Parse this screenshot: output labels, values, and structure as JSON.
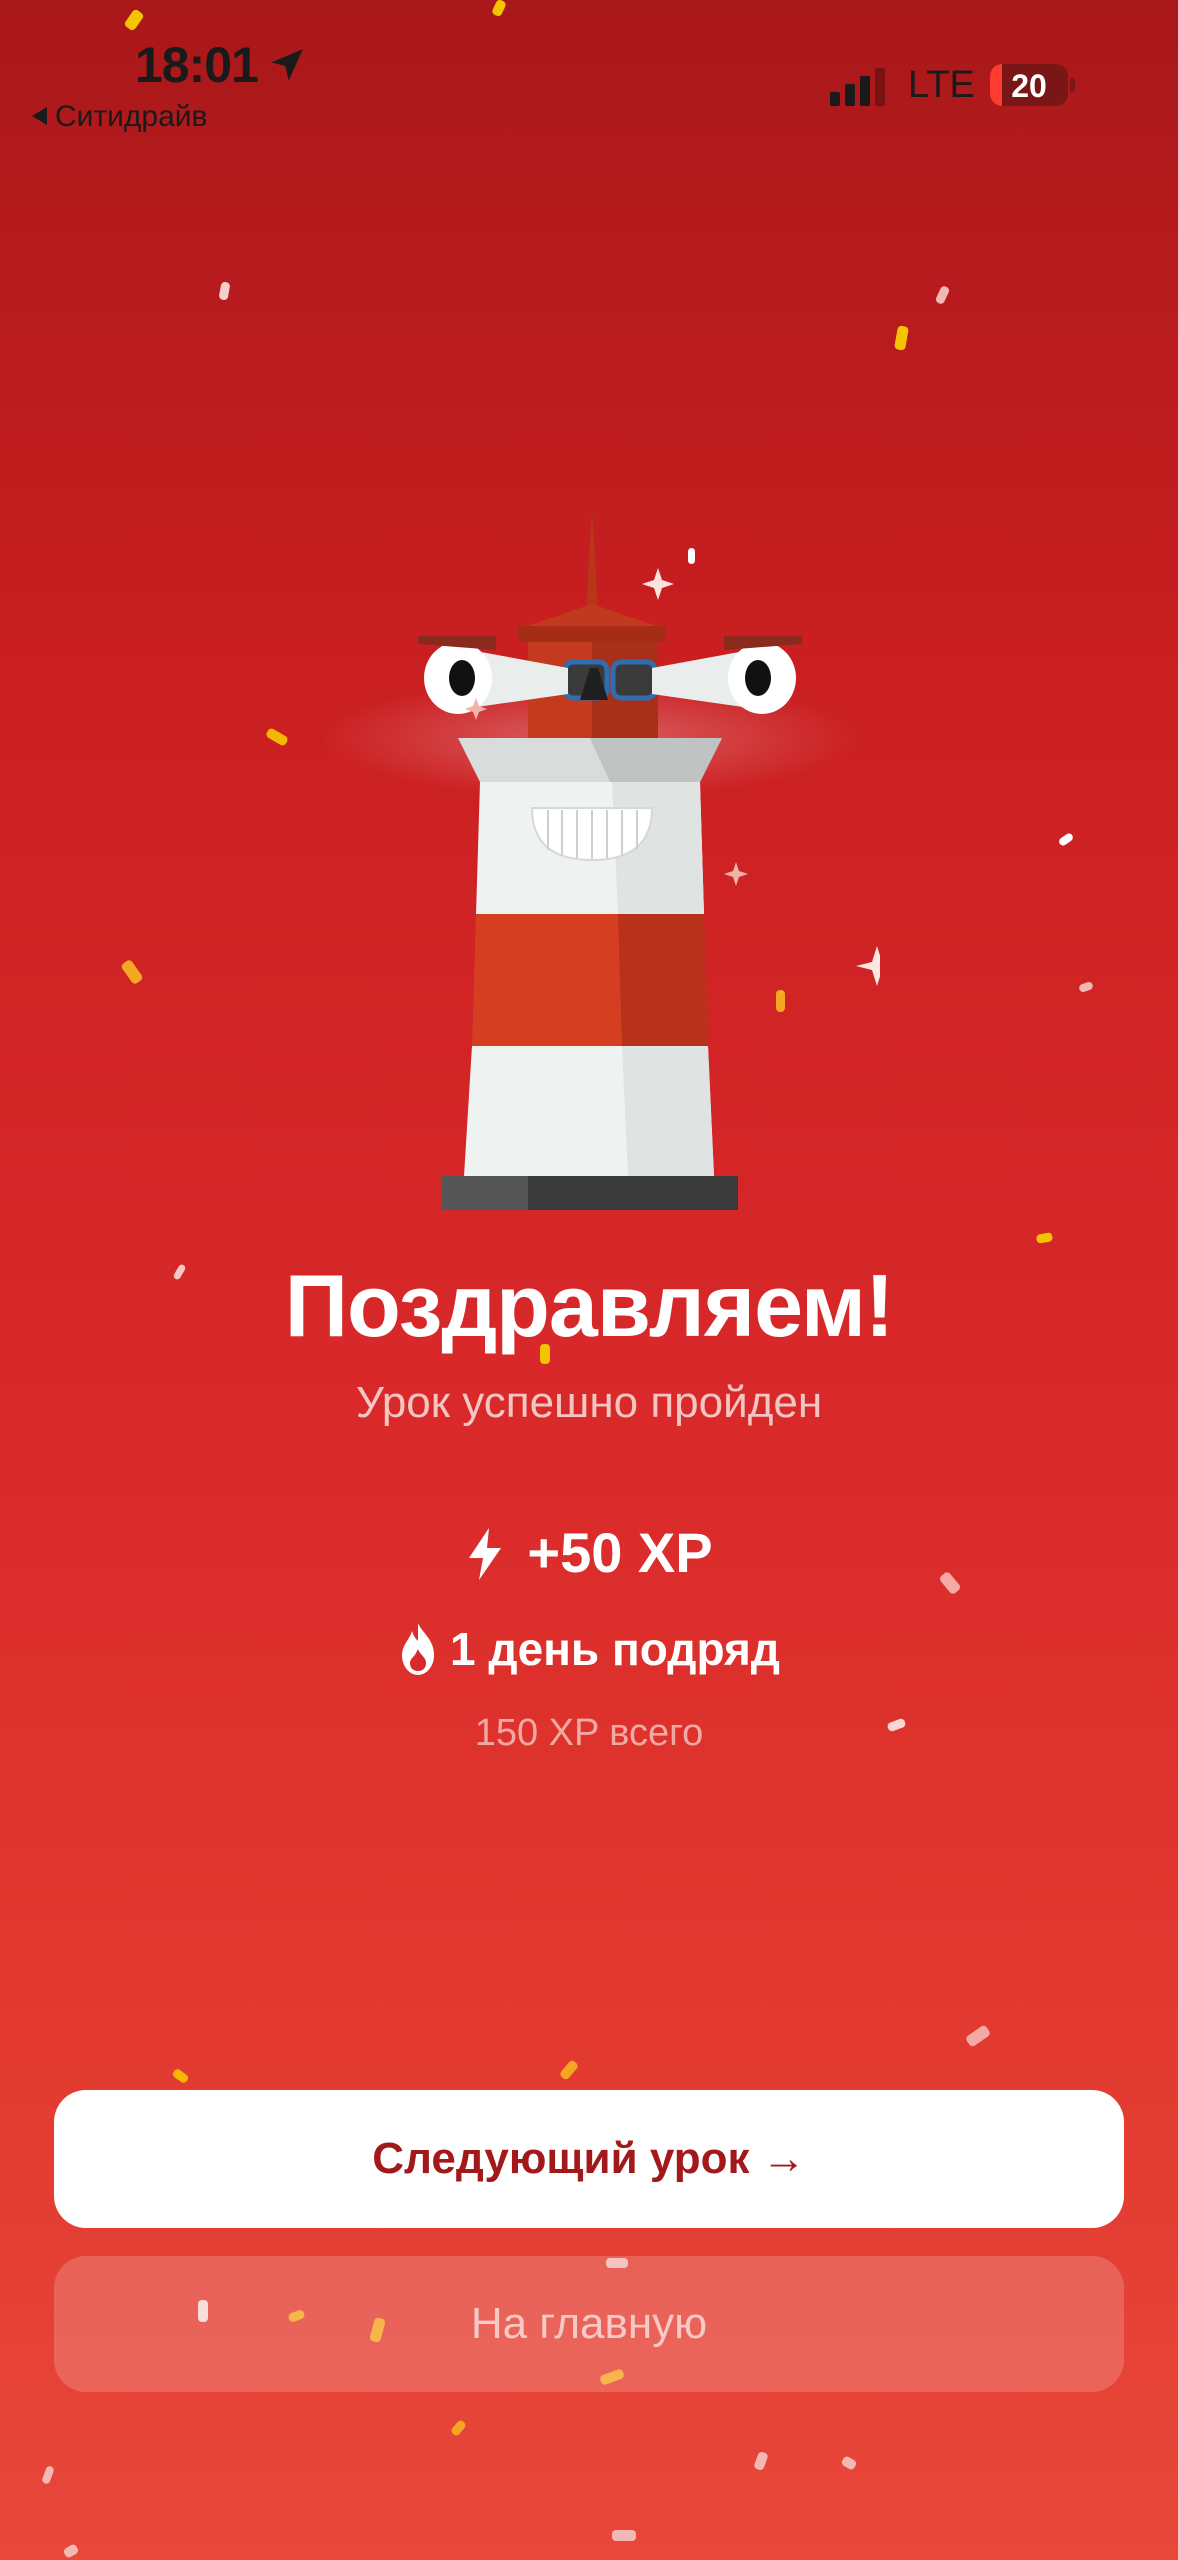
{
  "status_bar": {
    "time": "18:01",
    "back_app": "Ситидрайв",
    "network": "LTE",
    "battery": "20",
    "icons": [
      "location-arrow-icon",
      "signal-icon",
      "battery-icon"
    ]
  },
  "illustration": {
    "name": "lighthouse-mascot"
  },
  "result": {
    "title": "Поздравляем!",
    "subtitle": "Урок успешно пройден",
    "xp_gain": "+50 XP",
    "streak": "1 день подряд",
    "total_xp": "150 XP всего"
  },
  "actions": {
    "next_lesson": "Следующий урок →",
    "home": "На главную"
  },
  "colors": {
    "background_top": "#a9181a",
    "background_bottom": "#e8473a",
    "accent_text": "#a3191b",
    "confetti_yellow": "#f5b800"
  }
}
